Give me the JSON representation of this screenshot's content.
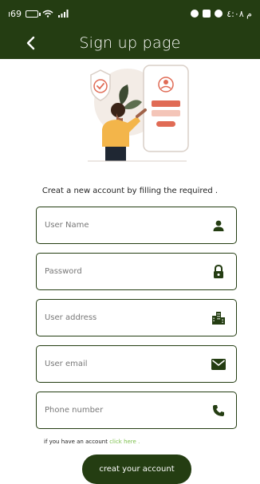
{
  "status_bar": {
    "left_text": "ı69",
    "right_text": "م ٤:٠٨"
  },
  "header": {
    "title": "Sign up page",
    "back_icon": "chevron-left-icon"
  },
  "subtitle": "Creat a new account by filling the required .",
  "fields": [
    {
      "name": "username",
      "placeholder": "User Name",
      "icon": "person-icon"
    },
    {
      "name": "password",
      "placeholder": "Password",
      "icon": "lock-icon"
    },
    {
      "name": "address",
      "placeholder": "User address",
      "icon": "building-icon"
    },
    {
      "name": "email",
      "placeholder": "User email",
      "icon": "mail-icon"
    },
    {
      "name": "phone",
      "placeholder": "Phone number",
      "icon": "phone-icon"
    }
  ],
  "signin_hint": {
    "text": "if you have an account",
    "link": "click here ."
  },
  "submit_label": "creat your account",
  "colors": {
    "primary": "#243d12",
    "link": "#7bbf4a",
    "illustration_accent": "#f3b54a"
  }
}
